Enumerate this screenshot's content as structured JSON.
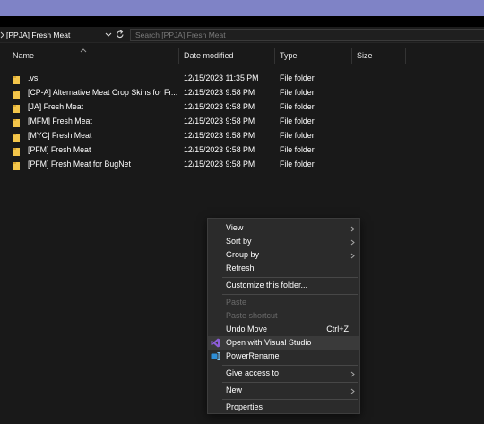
{
  "address": {
    "path": "[PPJA] Fresh Meat",
    "search_placeholder": "Search [PPJA] Fresh Meat"
  },
  "columns": {
    "name": "Name",
    "date": "Date modified",
    "type": "Type",
    "size": "Size"
  },
  "files": [
    {
      "name": ".vs",
      "date": "12/15/2023 11:35 PM",
      "type": "File folder"
    },
    {
      "name": "[CP-A] Alternative Meat Crop Skins for Fr...",
      "date": "12/15/2023 9:58 PM",
      "type": "File folder"
    },
    {
      "name": "[JA] Fresh Meat",
      "date": "12/15/2023 9:58 PM",
      "type": "File folder"
    },
    {
      "name": "[MFM] Fresh Meat",
      "date": "12/15/2023 9:58 PM",
      "type": "File folder"
    },
    {
      "name": "[MYC] Fresh Meat",
      "date": "12/15/2023 9:58 PM",
      "type": "File folder"
    },
    {
      "name": "[PFM] Fresh Meat",
      "date": "12/15/2023 9:58 PM",
      "type": "File folder"
    },
    {
      "name": "[PFM] Fresh Meat for BugNet",
      "date": "12/15/2023 9:58 PM",
      "type": "File folder"
    }
  ],
  "context_menu": {
    "view": "View",
    "sort_by": "Sort by",
    "group_by": "Group by",
    "refresh": "Refresh",
    "customize": "Customize this folder...",
    "paste": "Paste",
    "paste_shortcut": "Paste shortcut",
    "undo_move": "Undo Move",
    "undo_shortcut": "Ctrl+Z",
    "open_vs": "Open with Visual Studio",
    "power_rename": "PowerRename",
    "give_access": "Give access to",
    "new": "New",
    "properties": "Properties"
  },
  "colors": {
    "folder": "#f3c54a",
    "accent_strip": "#7f83c6",
    "visual_studio": "#8c5dd8",
    "power_rename": "#2e8fd8"
  }
}
